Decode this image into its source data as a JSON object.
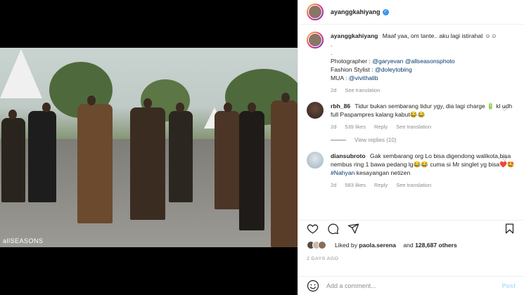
{
  "header": {
    "username": "ayanggkahiyang",
    "verified": true
  },
  "photo": {
    "watermark": "allSEASONS",
    "alt": "Procession of people in traditional batik attire"
  },
  "caption": {
    "username": "ayanggkahiyang",
    "text": "Maaf yaa, om tante.. aku lagi istirahat ☺☺",
    "dots": ".",
    "dots2": ".",
    "photographer_label": "Photographer : ",
    "photographer_1": "@garyevan",
    "photographer_2": "@allseasonsphoto",
    "stylist_label": "Fashion Stylist : ",
    "stylist": "@doleytobing",
    "mua_label": "MUA : ",
    "mua": "@vivithalib",
    "time": "2d",
    "see_translation": "See translation"
  },
  "comments": [
    {
      "username": "rbh_86",
      "text": "Tidur bukan sembarang tidur ygy, dia lagi charge 🔋 kl udh full Paspampres kalang kabut😂😂",
      "time": "2d",
      "likes": "539 likes",
      "reply": "Reply",
      "see_translation": "See translation",
      "view_replies": "View replies (10)"
    },
    {
      "username": "diansubroto",
      "text_1": "Gak sembarang org Lo bisa digendong walikota,bisa nembus ring 1 bawa pedang lg😂😂 cuma si Mr singlet yg bisa❤️🤩 ",
      "hashtag": "#Nahyan",
      "text_2": " kesayangan netizen",
      "time": "2d",
      "likes": "583 likes",
      "reply": "Reply",
      "see_translation": "See translation"
    }
  ],
  "likes": {
    "prefix": "Liked by ",
    "user": "paola.serena",
    "and": " and ",
    "count": "128,687 others"
  },
  "date": "2 DAYS AGO",
  "add_comment": {
    "placeholder": "Add a comment...",
    "post": "Post"
  },
  "icons": [
    "heart-icon",
    "comment-icon",
    "share-icon",
    "bookmark-icon",
    "emoji-icon",
    "verified-icon"
  ]
}
